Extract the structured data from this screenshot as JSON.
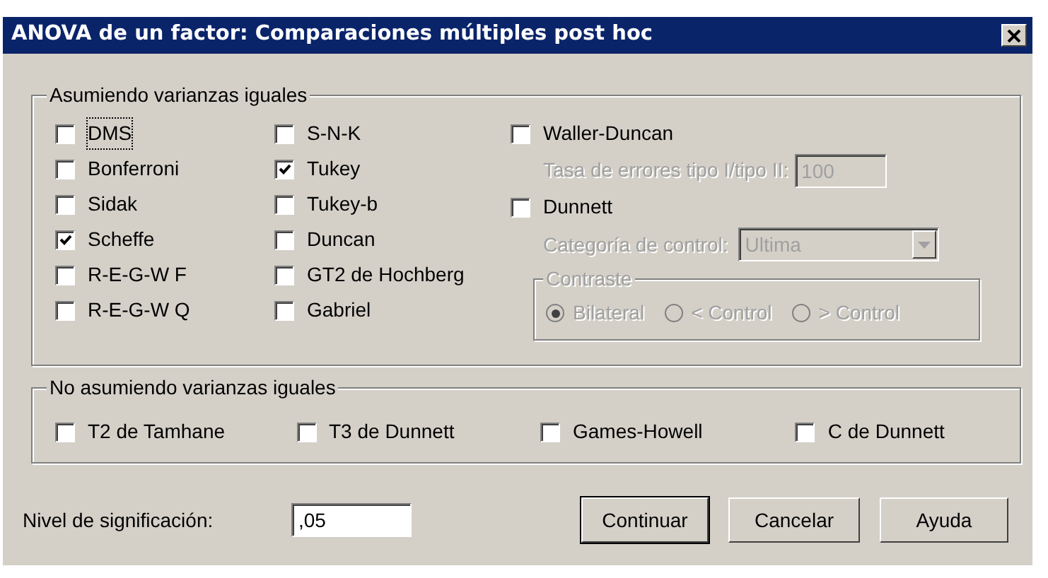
{
  "window": {
    "title": "ANOVA de un factor: Comparaciones múltiples post hoc"
  },
  "equal_variances": {
    "legend": "Asumiendo varianzas iguales",
    "columns": [
      [
        {
          "label": "DMS",
          "checked": false,
          "focused": true
        },
        {
          "label": "Bonferroni",
          "checked": false,
          "focused": false
        },
        {
          "label": "Sidak",
          "checked": false,
          "focused": false
        },
        {
          "label": "Scheffe",
          "checked": true,
          "focused": false
        },
        {
          "label": "R-E-G-W F",
          "checked": false,
          "focused": false
        },
        {
          "label": "R-E-G-W Q",
          "checked": false,
          "focused": false
        }
      ],
      [
        {
          "label": "S-N-K",
          "checked": false,
          "focused": false
        },
        {
          "label": "Tukey",
          "checked": true,
          "focused": false
        },
        {
          "label": "Tukey-b",
          "checked": false,
          "focused": false
        },
        {
          "label": "Duncan",
          "checked": false,
          "focused": false
        },
        {
          "label": "GT2 de Hochberg",
          "checked": false,
          "focused": false
        },
        {
          "label": "Gabriel",
          "checked": false,
          "focused": false
        }
      ]
    ],
    "waller": {
      "label": "Waller-Duncan",
      "checked": false
    },
    "error_rate": {
      "label": "Tasa de errores tipo I/tipo II:",
      "value": "100",
      "disabled": true
    },
    "dunnett": {
      "label": "Dunnett",
      "checked": false
    },
    "control_category": {
      "label": "Categoría de control:",
      "value": "Ultima",
      "disabled": true
    },
    "contrast": {
      "legend": "Contraste",
      "disabled": true,
      "options": [
        {
          "label": "Bilateral",
          "selected": true
        },
        {
          "label": "< Control",
          "selected": false
        },
        {
          "label": "> Control",
          "selected": false
        }
      ]
    }
  },
  "unequal_variances": {
    "legend": "No asumiendo varianzas iguales",
    "items": [
      {
        "label": "T2 de Tamhane",
        "checked": false
      },
      {
        "label": "T3 de Dunnett",
        "checked": false
      },
      {
        "label": "Games-Howell",
        "checked": false
      },
      {
        "label": "C de Dunnett",
        "checked": false
      }
    ]
  },
  "significance": {
    "label": "Nivel de significación:",
    "value": ",05"
  },
  "buttons": [
    {
      "label": "Continuar",
      "default": true
    },
    {
      "label": "Cancelar",
      "default": false
    },
    {
      "label": "Ayuda",
      "default": false
    }
  ]
}
